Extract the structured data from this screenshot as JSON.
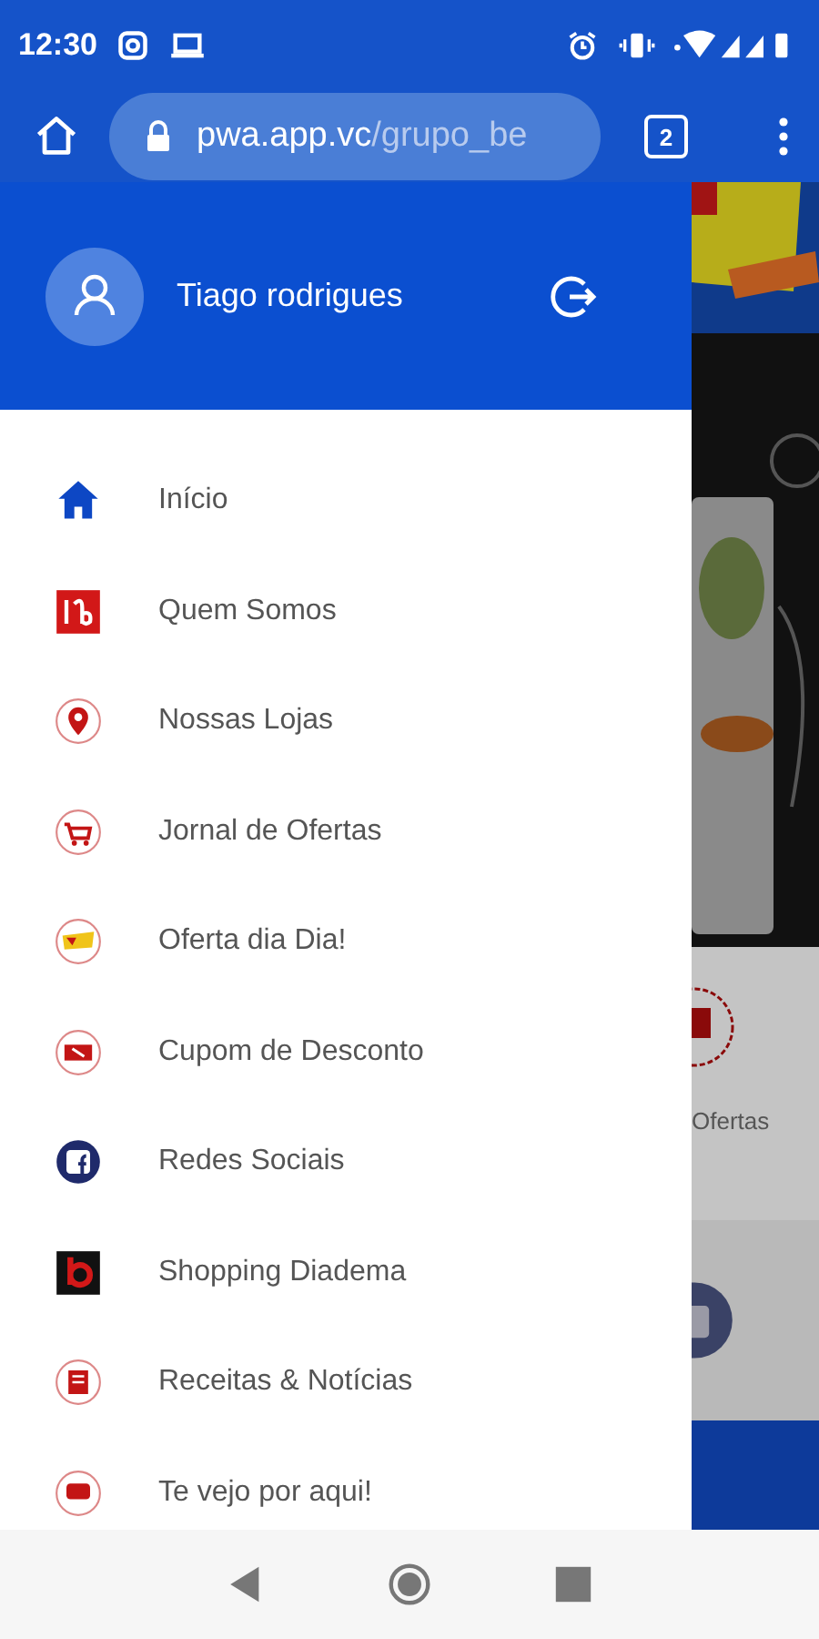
{
  "status_bar": {
    "time": "12:30"
  },
  "browser": {
    "url_host": "pwa.app.vc",
    "url_path": "/grupo_be",
    "tab_count": "2"
  },
  "drawer": {
    "user_name": "Tiago rodrigues",
    "items": [
      {
        "label": "Início",
        "kind": "home"
      },
      {
        "label": "Quem Somos",
        "kind": "brand"
      },
      {
        "label": "Nossas Lojas",
        "kind": "pin"
      },
      {
        "label": "Jornal de Ofertas",
        "kind": "cart"
      },
      {
        "label": "Oferta dia Dia!",
        "kind": "sale"
      },
      {
        "label": "Cupom de Desconto",
        "kind": "coupon"
      },
      {
        "label": "Redes Sociais",
        "kind": "social"
      },
      {
        "label": "Shopping Diadema",
        "kind": "shopping"
      },
      {
        "label": "Receitas & Notícias",
        "kind": "news"
      },
      {
        "label": "Te vejo por aqui!",
        "kind": "greeting"
      }
    ]
  },
  "behind": {
    "label": "Ofertas"
  }
}
